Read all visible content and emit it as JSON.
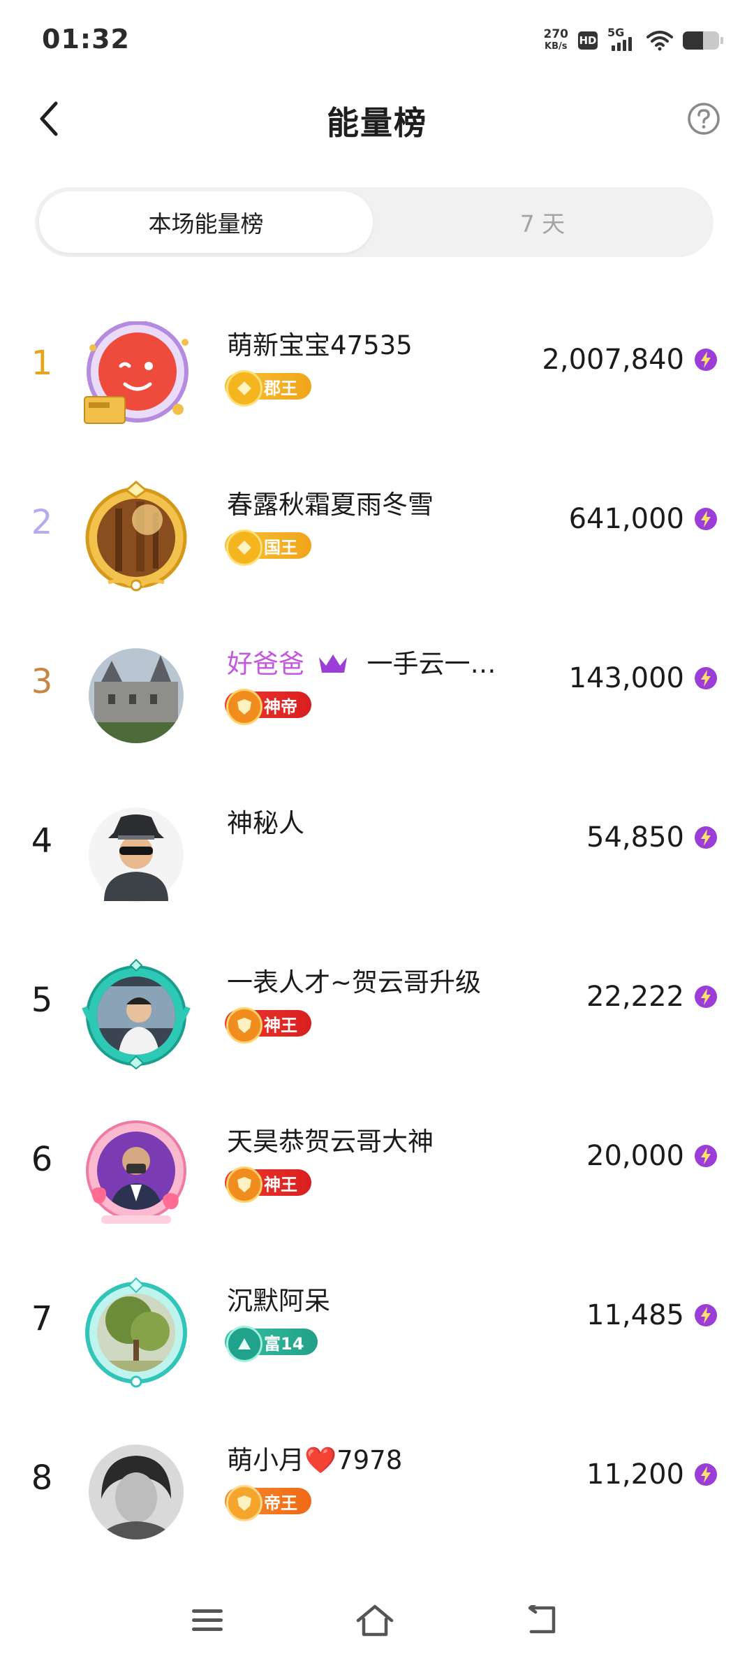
{
  "status_bar": {
    "time": "01:32",
    "net_speed_value": "270",
    "net_speed_unit": "KB/s",
    "hd_label": "HD",
    "signal_label": "5G",
    "battery_level": 0.55
  },
  "header": {
    "title": "能量榜"
  },
  "tabs": [
    {
      "label": "本场能量榜",
      "active": true
    },
    {
      "label": "7 天",
      "active": false
    }
  ],
  "ranking": [
    {
      "rank": "1",
      "name": "萌新宝宝47535",
      "badge": "郡王",
      "score": "2,007,840"
    },
    {
      "rank": "2",
      "name": "春露秋霜夏雨冬雪",
      "badge": "国王",
      "score": "641,000"
    },
    {
      "rank": "3",
      "name_primary": "好爸爸",
      "name": "一手云一…",
      "badge": "神帝",
      "score": "143,000"
    },
    {
      "rank": "4",
      "name": "神秘人",
      "badge": "",
      "score": "54,850"
    },
    {
      "rank": "5",
      "name": "一表人才~贺云哥升级",
      "badge": "神王",
      "score": "22,222"
    },
    {
      "rank": "6",
      "name": "天昊恭贺云哥大神",
      "badge": "神王",
      "score": "20,000"
    },
    {
      "rank": "7",
      "name": "沉默阿呆",
      "badge": "富14",
      "score": "11,485"
    },
    {
      "rank": "8",
      "name": "萌小月❤️7978",
      "badge": "帝王",
      "score": "11,200"
    }
  ],
  "colors": {
    "rank1": "#e6a417",
    "rank2": "#b6aaf0",
    "rank3": "#c98543",
    "gold_badge": "#f0b323",
    "red_badge": "#e8312b",
    "orange_badge": "#f07c22",
    "teal_badge": "#2fb39a",
    "energy": "#9a3dd9"
  },
  "icons": {
    "back": "chevron-left-icon",
    "help": "question-circle-icon",
    "energy": "lightning-icon",
    "crown": "crown-icon",
    "nav_menu": "menu-icon",
    "nav_home": "home-icon",
    "nav_back": "back-arrow-icon"
  }
}
